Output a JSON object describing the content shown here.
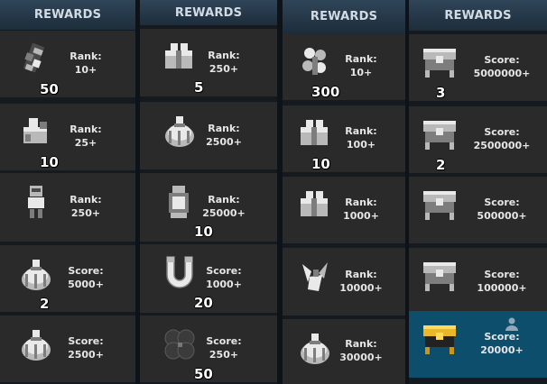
{
  "colors": {
    "header_bg": "#243849",
    "cell_bg": "#2a2a2a",
    "highlight_bg": "#0d4e6c",
    "qty_text": "#ffffff",
    "req_text": "#e6e6e6"
  },
  "columns": [
    {
      "header": "REWARDS",
      "rewards": [
        {
          "icon": "token-icon",
          "qty": "50",
          "req_label": "Rank:",
          "req_value": "10+"
        },
        {
          "icon": "crystal-box-icon",
          "qty": "10",
          "req_label": "Rank:",
          "req_value": "25+"
        },
        {
          "icon": "armor-figure-icon",
          "qty": "",
          "req_label": "Rank:",
          "req_value": "250+"
        },
        {
          "icon": "dome-relic-icon",
          "qty": "2",
          "req_label": "Score:",
          "req_value": "5000+"
        },
        {
          "icon": "dome-relic-icon",
          "qty": "",
          "req_label": "Score:",
          "req_value": "2500+"
        }
      ]
    },
    {
      "header": "REWARDS",
      "rewards": [
        {
          "icon": "gift-box-icon",
          "qty": "5",
          "req_label": "Rank:",
          "req_value": "250+"
        },
        {
          "icon": "dome-relic-icon",
          "qty": "",
          "req_label": "Rank:",
          "req_value": "2500+"
        },
        {
          "icon": "lantern-icon",
          "qty": "10",
          "req_label": "Rank:",
          "req_value": "25000+"
        },
        {
          "icon": "horseshoe-magnet-icon",
          "qty": "20",
          "req_label": "Score:",
          "req_value": "1000+"
        },
        {
          "icon": "dark-clover-icon",
          "qty": "50",
          "req_label": "Score:",
          "req_value": "250+"
        }
      ]
    },
    {
      "header": "REWARDS",
      "rewards": [
        {
          "icon": "flower-cluster-icon",
          "qty": "300",
          "req_label": "Rank:",
          "req_value": "10+"
        },
        {
          "icon": "gift-box-icon",
          "qty": "10",
          "req_label": "Rank:",
          "req_value": "100+"
        },
        {
          "icon": "gift-box-icon",
          "qty": "",
          "req_label": "Rank:",
          "req_value": "1000+"
        },
        {
          "icon": "shard-cluster-icon",
          "qty": "",
          "req_label": "Rank:",
          "req_value": "10000+"
        },
        {
          "icon": "dome-relic-icon",
          "qty": "",
          "req_label": "Rank:",
          "req_value": "30000+"
        }
      ]
    },
    {
      "header": "REWARDS",
      "rewards": [
        {
          "icon": "chest-icon",
          "qty": "3",
          "req_label": "Score:",
          "req_value": "5000000+"
        },
        {
          "icon": "chest-icon",
          "qty": "2",
          "req_label": "Score:",
          "req_value": "2500000+"
        },
        {
          "icon": "chest-icon",
          "qty": "",
          "req_label": "Score:",
          "req_value": "500000+"
        },
        {
          "icon": "chest-icon",
          "qty": "",
          "req_label": "Score:",
          "req_value": "100000+"
        },
        {
          "icon": "gold-chest-icon",
          "qty": "",
          "req_label": "Score:",
          "req_value": "20000+",
          "highlighted": true,
          "player_marker": "player-icon"
        }
      ]
    }
  ]
}
